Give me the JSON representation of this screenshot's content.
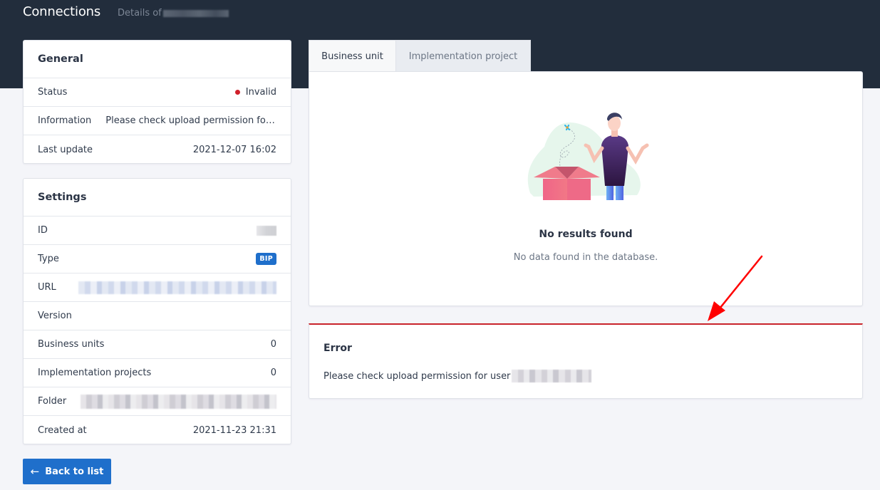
{
  "header": {
    "title": "Connections",
    "subtitle": "Details of"
  },
  "general": {
    "title": "General",
    "rows": [
      {
        "label": "Status",
        "value": "Invalid"
      },
      {
        "label": "Information",
        "value": "Please check upload permission for user"
      },
      {
        "label": "Last update",
        "value": "2021-12-07 16:02"
      }
    ],
    "status_color": "#d0202a"
  },
  "settings": {
    "title": "Settings",
    "rows": [
      {
        "label": "ID",
        "value": ""
      },
      {
        "label": "Type",
        "value": "BIP"
      },
      {
        "label": "URL",
        "value": ""
      },
      {
        "label": "Version",
        "value": ""
      },
      {
        "label": "Business units",
        "value": "0"
      },
      {
        "label": "Implementation projects",
        "value": "0"
      },
      {
        "label": "Folder",
        "value": ""
      },
      {
        "label": "Created at",
        "value": "2021-11-23 21:31"
      }
    ],
    "badge_color": "#1f6fcb"
  },
  "back_button": {
    "icon": "arrow-left-icon",
    "label": "Back to list"
  },
  "tabs": [
    {
      "label": "Business unit",
      "active": true
    },
    {
      "label": "Implementation project",
      "active": false
    }
  ],
  "results": {
    "illustration": "empty-box-illustration",
    "empty_title": "No results found",
    "empty_subtitle": "No data found in the database."
  },
  "error": {
    "title": "Error",
    "message": "Please check upload permission for user",
    "accent_color": "#c9242b"
  },
  "colors": {
    "header_bg": "#222d3c",
    "primary": "#1f6fcb",
    "page_bg": "#f4f5f9"
  }
}
